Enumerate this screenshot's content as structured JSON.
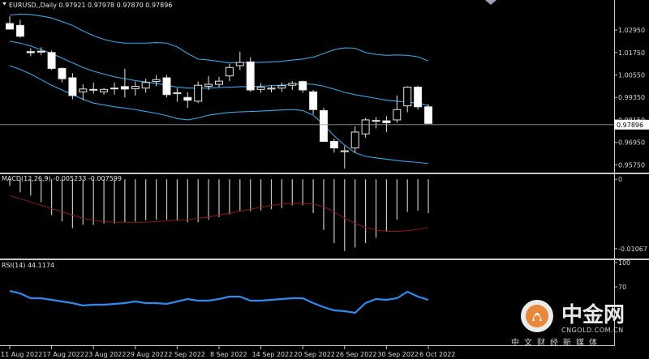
{
  "chart_data": [
    {
      "type": "candlestick",
      "panel": "price",
      "title": "EURUSD,,Daily  0.97921 0.97978 0.97870 0.97896",
      "symbol": "EURUSD",
      "timeframe": "Daily",
      "last_price_label": "0.97896",
      "ylim": [
        0.9555,
        1.0395
      ],
      "y_ticks": [
        "1.02950",
        "1.01750",
        "1.00550",
        "0.99350",
        "0.98150",
        "0.96950",
        "0.95750"
      ],
      "y_tick_values": [
        1.0295,
        1.0175,
        1.0055,
        0.9935,
        0.9815,
        0.9695,
        0.9575
      ],
      "x_labels": [
        "11 Aug 2022",
        "17 Aug 2022",
        "23 Aug 2022",
        "29 Aug 2022",
        "2 Sep 2022",
        "8 Sep 2022",
        "14 Sep 2022",
        "20 Sep 2022",
        "26 Sep 2022",
        "30 Sep 2022",
        "6 Oct 2022"
      ],
      "x_label_bars": [
        0,
        4,
        8,
        12,
        16,
        20,
        24,
        28,
        32,
        36,
        40
      ],
      "candles": [
        {
          "o": 1.033,
          "h": 1.0368,
          "l": 1.0298,
          "c": 1.03
        },
        {
          "o": 1.032,
          "h": 1.035,
          "l": 1.0255,
          "c": 1.0262
        },
        {
          "o": 1.018,
          "h": 1.0198,
          "l": 1.0155,
          "c": 1.0174
        },
        {
          "o": 1.0182,
          "h": 1.0203,
          "l": 1.0162,
          "c": 1.0177
        },
        {
          "o": 1.0175,
          "h": 1.0185,
          "l": 1.0082,
          "c": 1.009
        },
        {
          "o": 1.009,
          "h": 1.0095,
          "l": 1.0015,
          "c": 1.0035
        },
        {
          "o": 1.004,
          "h": 1.0065,
          "l": 0.9925,
          "c": 0.9945
        },
        {
          "o": 0.9965,
          "h": 1.0005,
          "l": 0.992,
          "c": 0.998
        },
        {
          "o": 0.9975,
          "h": 1.0015,
          "l": 0.9955,
          "c": 0.9978
        },
        {
          "o": 0.9965,
          "h": 0.9985,
          "l": 0.995,
          "c": 0.9978
        },
        {
          "o": 0.9985,
          "h": 1.0015,
          "l": 0.995,
          "c": 0.9985
        },
        {
          "o": 0.9993,
          "h": 1.0088,
          "l": 0.9935,
          "c": 0.998
        },
        {
          "o": 0.9982,
          "h": 1.002,
          "l": 0.9945,
          "c": 0.9994
        },
        {
          "o": 0.9985,
          "h": 1.0035,
          "l": 0.996,
          "c": 1.0015
        },
        {
          "o": 1.002,
          "h": 1.0055,
          "l": 0.9995,
          "c": 1.003
        },
        {
          "o": 1.004,
          "h": 1.0055,
          "l": 0.9935,
          "c": 0.995
        },
        {
          "o": 0.9955,
          "h": 0.9985,
          "l": 0.9912,
          "c": 0.996
        },
        {
          "o": 0.9935,
          "h": 0.9962,
          "l": 0.988,
          "c": 0.992
        },
        {
          "o": 0.9915,
          "h": 1.002,
          "l": 0.9905,
          "c": 1.0
        },
        {
          "o": 0.9995,
          "h": 1.005,
          "l": 0.9975,
          "c": 1.0005
        },
        {
          "o": 1.0005,
          "h": 1.0045,
          "l": 0.999,
          "c": 1.0022
        },
        {
          "o": 1.005,
          "h": 1.0115,
          "l": 1.0022,
          "c": 1.0095
        },
        {
          "o": 1.0105,
          "h": 1.018,
          "l": 1.0082,
          "c": 1.0122
        },
        {
          "o": 1.0125,
          "h": 1.015,
          "l": 0.9965,
          "c": 0.9975
        },
        {
          "o": 0.9978,
          "h": 1.0012,
          "l": 0.996,
          "c": 0.999
        },
        {
          "o": 0.998,
          "h": 1.0,
          "l": 0.9962,
          "c": 0.9985
        },
        {
          "o": 0.9985,
          "h": 1.0015,
          "l": 0.9965,
          "c": 0.9998
        },
        {
          "o": 1.0,
          "h": 1.0022,
          "l": 0.9975,
          "c": 1.001
        },
        {
          "o": 1.002,
          "h": 1.0025,
          "l": 0.996,
          "c": 0.9975
        },
        {
          "o": 0.9965,
          "h": 0.9975,
          "l": 0.9845,
          "c": 0.987
        },
        {
          "o": 0.9865,
          "h": 0.988,
          "l": 0.9725,
          "c": 0.97
        },
        {
          "o": 0.97,
          "h": 0.9715,
          "l": 0.964,
          "c": 0.9665
        },
        {
          "o": 0.9645,
          "h": 0.9675,
          "l": 0.9555,
          "c": 0.965
        },
        {
          "o": 0.9665,
          "h": 0.978,
          "l": 0.964,
          "c": 0.975
        },
        {
          "o": 0.974,
          "h": 0.9825,
          "l": 0.972,
          "c": 0.9815
        },
        {
          "o": 0.981,
          "h": 0.983,
          "l": 0.977,
          "c": 0.9812
        },
        {
          "o": 0.981,
          "h": 0.9835,
          "l": 0.975,
          "c": 0.98
        },
        {
          "o": 0.9815,
          "h": 0.9945,
          "l": 0.98,
          "c": 0.987
        },
        {
          "o": 0.989,
          "h": 0.9995,
          "l": 0.9855,
          "c": 0.999
        },
        {
          "o": 0.999,
          "h": 0.9998,
          "l": 0.987,
          "c": 0.9885
        },
        {
          "o": 0.9885,
          "h": 0.9898,
          "l": 0.9795,
          "c": 0.9796
        }
      ],
      "bollinger": {
        "color": "#38a6e6",
        "upper": [
          1.0375,
          1.038,
          1.0378,
          1.037,
          1.036,
          1.034,
          1.032,
          1.029,
          1.0265,
          1.0245,
          1.0232,
          1.0225,
          1.0225,
          1.0225,
          1.0228,
          1.0225,
          1.0205,
          1.017,
          1.014,
          1.0135,
          1.0128,
          1.012,
          1.0122,
          1.0122,
          1.0122,
          1.0125,
          1.0128,
          1.0135,
          1.014,
          1.015,
          1.017,
          1.019,
          1.02,
          1.0198,
          1.0175,
          1.0165,
          1.016,
          1.0162,
          1.016,
          1.0152,
          1.013
        ],
        "middle": [
          1.0235,
          1.0225,
          1.021,
          1.019,
          1.017,
          1.0145,
          1.012,
          1.0095,
          1.0075,
          1.006,
          1.0045,
          1.0035,
          1.0025,
          1.0018,
          1.001,
          1.0,
          0.999,
          0.9985,
          0.9985,
          0.9985,
          0.9988,
          0.999,
          0.9992,
          0.9993,
          0.9995,
          0.9998,
          1.0,
          1.0005,
          1.0008,
          1.0005,
          0.9995,
          0.998,
          0.9962,
          0.995,
          0.994,
          0.993,
          0.992,
          0.9915,
          0.991,
          0.9905,
          0.9892
        ],
        "lower": [
          1.0105,
          1.0085,
          1.006,
          1.003,
          1.0,
          0.9975,
          0.995,
          0.9925,
          0.9905,
          0.9895,
          0.9885,
          0.9878,
          0.987,
          0.986,
          0.985,
          0.9838,
          0.9822,
          0.9815,
          0.9825,
          0.984,
          0.9848,
          0.9855,
          0.9858,
          0.986,
          0.9862,
          0.9865,
          0.9868,
          0.987,
          0.9865,
          0.984,
          0.979,
          0.973,
          0.968,
          0.964,
          0.962,
          0.9612,
          0.9605,
          0.9598,
          0.9592,
          0.9588,
          0.9582
        ]
      }
    },
    {
      "type": "bar",
      "panel": "macd",
      "title": "MACD(12,26,9) -0.005233 -0.007599",
      "y_ticks": [
        "0",
        "-0.01067"
      ],
      "y_tick_values": [
        0,
        -0.01067
      ],
      "ylim": [
        -0.0118,
        0.0004
      ],
      "histogram": [
        -0.001,
        -0.002,
        -0.0025,
        -0.0035,
        -0.0055,
        -0.0065,
        -0.0075,
        -0.007,
        -0.007,
        -0.0068,
        -0.0068,
        -0.0066,
        -0.0065,
        -0.0063,
        -0.0062,
        -0.0062,
        -0.0064,
        -0.0066,
        -0.0066,
        -0.0062,
        -0.0058,
        -0.0054,
        -0.0049,
        -0.0049,
        -0.0048,
        -0.0046,
        -0.0044,
        -0.004,
        -0.004,
        -0.0052,
        -0.0078,
        -0.0098,
        -0.011,
        -0.0105,
        -0.0098,
        -0.009,
        -0.008,
        -0.0062,
        -0.005,
        -0.0048,
        -0.0052
      ],
      "signal_color": "#8b1a1a",
      "signal": [
        -0.0025,
        -0.003,
        -0.0035,
        -0.004,
        -0.0045,
        -0.005,
        -0.0055,
        -0.006,
        -0.0063,
        -0.0065,
        -0.0066,
        -0.0066,
        -0.0066,
        -0.0066,
        -0.0065,
        -0.0064,
        -0.0063,
        -0.0062,
        -0.006,
        -0.0058,
        -0.0055,
        -0.0052,
        -0.0049,
        -0.0046,
        -0.0043,
        -0.004,
        -0.0038,
        -0.0037,
        -0.0037,
        -0.0038,
        -0.0042,
        -0.005,
        -0.006,
        -0.0068,
        -0.0074,
        -0.0078,
        -0.008,
        -0.008,
        -0.0079,
        -0.0077,
        -0.0074
      ]
    },
    {
      "type": "line",
      "panel": "rsi",
      "title": "RSI(14) 44.1174",
      "y_ticks": [
        "100",
        "70"
      ],
      "y_tick_values": [
        100,
        70
      ],
      "ylim": [
        0,
        100
      ],
      "color": "#2e8bf0",
      "values": [
        65,
        62,
        56,
        56,
        54,
        52,
        50,
        47,
        48,
        48,
        49,
        50,
        52,
        50,
        50,
        49,
        52,
        55,
        53,
        53,
        55,
        58,
        58,
        53,
        53,
        54,
        55,
        56,
        56,
        50,
        45,
        41,
        40,
        38,
        50,
        55,
        54,
        56,
        64,
        58,
        54
      ]
    }
  ],
  "watermark": {
    "cn": "中金网",
    "en": "CNGOLD.COM.CN",
    "sub": "中文财经新媒体"
  },
  "colors": {
    "background": "#000000",
    "axis": "#c8c8c8",
    "candle_up": "#000000",
    "candle_down": "#ffffff",
    "candle_outline": "#e6e6e6",
    "macd_histogram": "#c8c8c8"
  }
}
